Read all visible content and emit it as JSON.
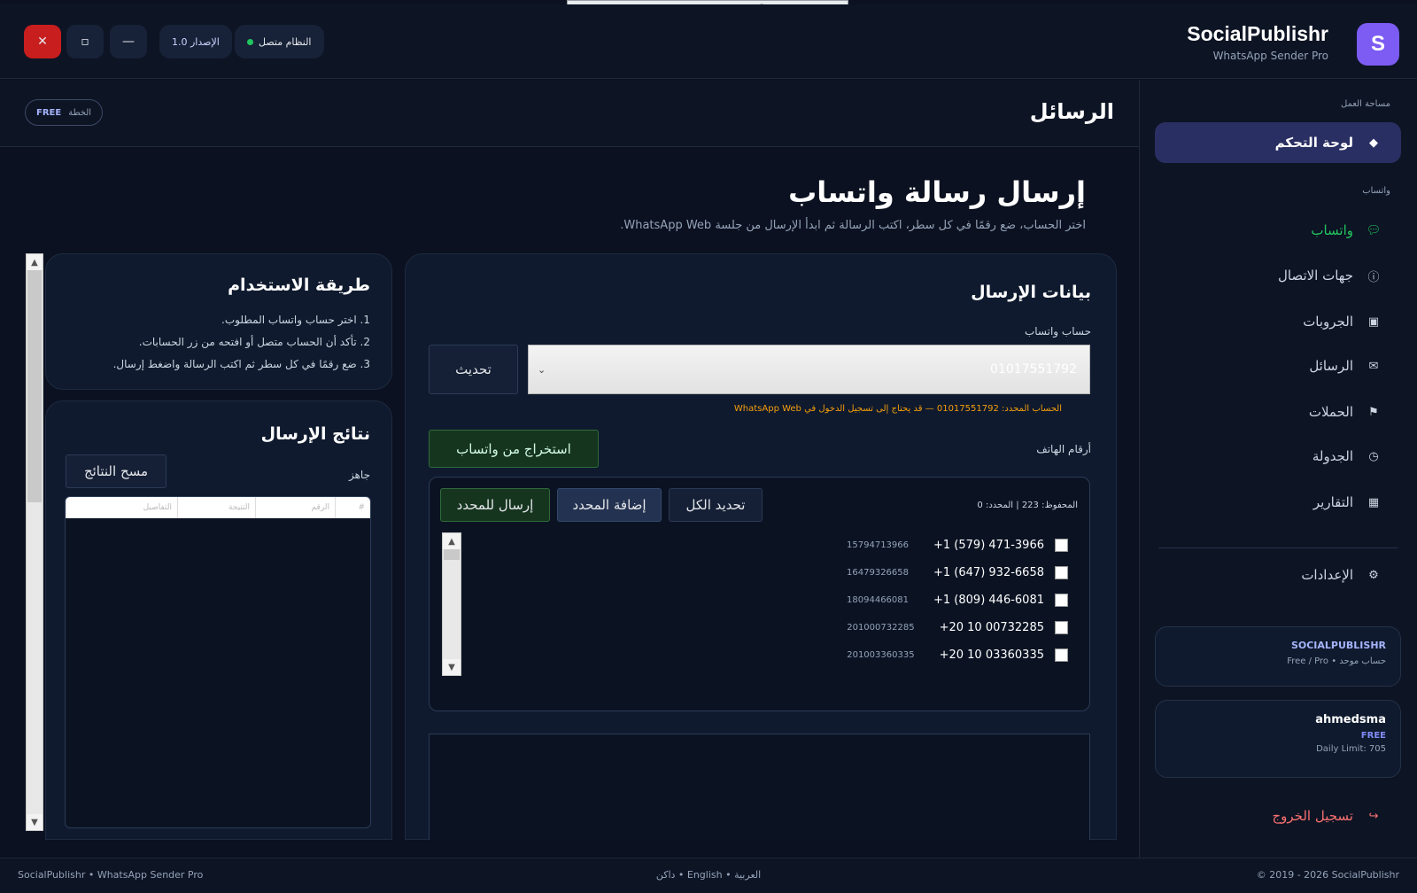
{
  "window": {
    "app_name": "SocialPublishr",
    "app_subtitle": "WhatsApp Sender Pro",
    "logo_letter": "S",
    "status_text": "النظام متصل",
    "version_text": "الإصدار 1.0",
    "minimize_label": "—",
    "maximize_label": "▫",
    "close_label": "✕",
    "floatbar_count": "2"
  },
  "colors": {
    "accent": "#7c5cf2",
    "success": "#22c55e",
    "warning": "#f59e0b",
    "danger": "#dc2626",
    "logout": "#f87171"
  },
  "sidebar": {
    "workspace_label": "مساحة العمل",
    "dashboard_label": "لوحة التحكم",
    "whatsapp_section_label": "واتساب",
    "items": [
      {
        "label": "واتساب",
        "icon": "chat-bubble-icon"
      },
      {
        "label": "جهات الاتصال",
        "icon": "info-icon"
      },
      {
        "label": "الجروبات",
        "icon": "group-icon"
      },
      {
        "label": "الرسائل",
        "icon": "envelope-icon"
      },
      {
        "label": "الحملات",
        "icon": "flag-icon"
      },
      {
        "label": "الجدولة",
        "icon": "clock-icon"
      },
      {
        "label": "التقارير",
        "icon": "report-icon"
      }
    ],
    "settings_label": "الإعدادات",
    "account_card": {
      "brand": "SOCIALPUBLISHR",
      "detail": "حساب موحد • Free / Pro"
    },
    "user_card": {
      "username": "ahmedsma",
      "plan": "FREE",
      "limit": "Daily Limit: 705"
    },
    "logout_label": "تسجيل الخروج"
  },
  "topbar": {
    "title": "الرسائل",
    "plan_label": "الخطة",
    "plan_value": "FREE"
  },
  "main": {
    "heading": "إرسال رسالة واتساب",
    "subheading": "اختر الحساب، ضع رقمًا في كل سطر، اكتب الرسالة ثم ابدأ الإرسال من جلسة WhatsApp Web.",
    "send_panel": {
      "title": "بيانات الإرسال",
      "account_label": "حساب واتساب",
      "account_value": "01017551792",
      "refresh_label": "تحديث",
      "account_warning": "الحساب المحدد: 01017551792 — قد يحتاج إلى تسجيل الدخول في WhatsApp Web",
      "phones_label": "أرقام الهاتف",
      "extract_label": "استخراج من واتساب",
      "stats": "المحفوظ: 223 | المحدد: 0",
      "select_all_label": "تحديد الكل",
      "add_selected_label": "إضافة المحدد",
      "send_selected_label": "إرسال للمحدد",
      "phones": [
        {
          "formatted": "+1 (579) 471-3966",
          "raw": "15794713966"
        },
        {
          "formatted": "+1 (647) 932-6658",
          "raw": "16479326658"
        },
        {
          "formatted": "+1 (809) 446-6081",
          "raw": "18094466081"
        },
        {
          "formatted": "+20 10 00732285",
          "raw": "201000732285"
        },
        {
          "formatted": "+20 10 03360335",
          "raw": "201003360335"
        }
      ]
    },
    "howto": {
      "title": "طريقة الاستخدام",
      "steps": [
        "1. اختر حساب واتساب المطلوب.",
        "2. تأكد أن الحساب متصل أو افتحه من زر الحسابات.",
        "3. ضع رقمًا في كل سطر ثم اكتب الرسالة واضغط إرسال."
      ]
    },
    "results": {
      "title": "نتائج الإرسال",
      "status": "جاهز",
      "clear_label": "مسح النتائج",
      "columns": [
        "#",
        "الرقم",
        "النتيجة",
        "التفاصيل"
      ]
    }
  },
  "footer": {
    "left": "SocialPublishr • WhatsApp Sender Pro",
    "center": "العربية • English • داكن",
    "right": "© 2019 - 2026 SocialPublishr"
  }
}
